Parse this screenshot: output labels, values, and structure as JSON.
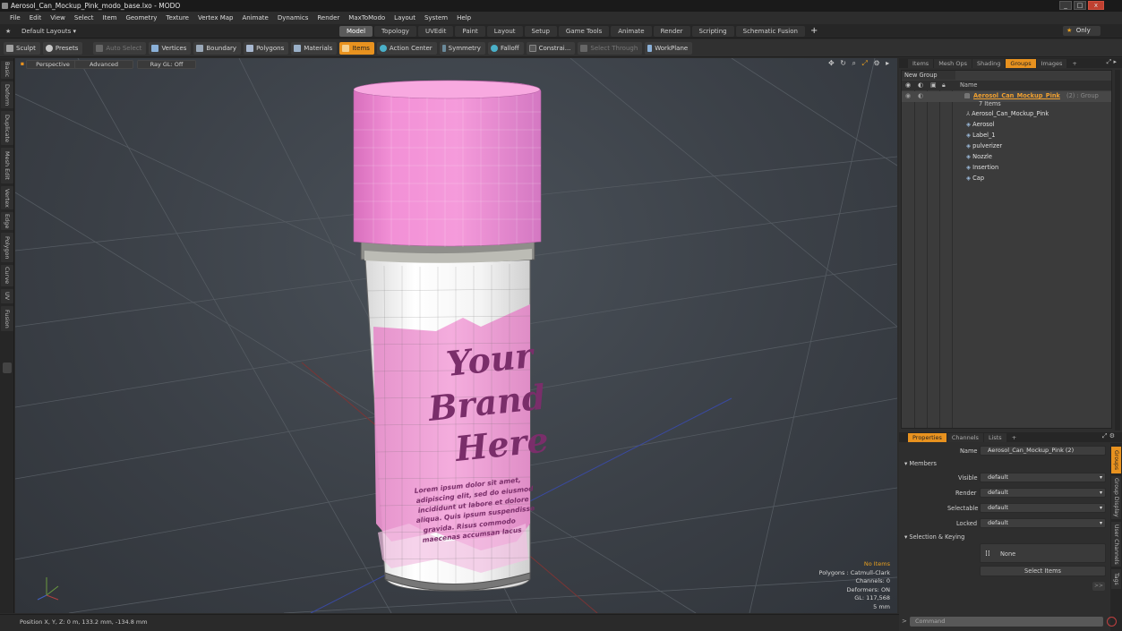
{
  "window": {
    "title": "Aerosol_Can_Mockup_Pink_modo_base.lxo - MODO",
    "controls": [
      "_",
      "□",
      "x"
    ]
  },
  "menu": [
    "File",
    "Edit",
    "View",
    "Select",
    "Item",
    "Geometry",
    "Texture",
    "Vertex Map",
    "Animate",
    "Dynamics",
    "Render",
    "MaxToModo",
    "Layout",
    "System",
    "Help"
  ],
  "layouts": {
    "layout_select": "Default Layouts",
    "tabs": [
      "Model",
      "Topology",
      "UVEdit",
      "Paint",
      "Layout",
      "Setup",
      "Game Tools",
      "Animate",
      "Render",
      "Scripting",
      "Schematic Fusion"
    ],
    "active": "Model",
    "add": "+",
    "only": "Only"
  },
  "toolbar": {
    "sculpt": "Sculpt",
    "presets": "Presets",
    "auto_select": "Auto Select",
    "vertices": "Vertices",
    "boundary": "Boundary",
    "polygons": "Polygons",
    "materials": "Materials",
    "items": "Items",
    "action_center": "Action Center",
    "symmetry": "Symmetry",
    "falloff": "Falloff",
    "constraints": "Constrai...",
    "select_through": "Select Through",
    "workplane": "WorkPlane"
  },
  "left_tabs": [
    "Basic",
    "Deform",
    "Duplicate",
    "Mesh Edit",
    "Vertex",
    "Edge",
    "Polygon",
    "Curve",
    "UV",
    "Fusion"
  ],
  "viewport": {
    "view_mode": "Perspective",
    "shading": "Advanced",
    "ray_gl": "Ray GL: Off",
    "label_text": [
      "Your",
      "Brand",
      "Here"
    ],
    "lorem": [
      "Lorem ipsum dolor sit amet,",
      "adipiscing elit, sed do eiusmod",
      "incididunt ut labore et dolore",
      "aliqua. Quis ipsum suspendisse",
      "gravida. Risus commodo",
      "maecenas accumsan lacus"
    ],
    "stats": {
      "no_items": "No Items",
      "polygons": "Polygons : Catmull-Clark",
      "channels": "Channels: 0",
      "deformers": "Deformers: ON",
      "gl": "GL: 117,568",
      "unit": "5 mm"
    },
    "colors": {
      "can_pink": "#ee8fd1",
      "text_purple": "#7a2e6a",
      "band": "#8a8a86"
    }
  },
  "status": {
    "position": "Position X, Y, Z:  0 m, 133.2 mm, -134.8 mm"
  },
  "right_panel": {
    "top_tabs": [
      "Items",
      "Mesh Ops",
      "Shading",
      "Groups",
      "Images",
      "+"
    ],
    "active_top_tab": "Groups",
    "new_group": "New Group",
    "name_header": "Name",
    "group": {
      "name": "Aerosol_Can_Mockup_Pink",
      "suffix": "(2) : Group",
      "count": "7 Items",
      "children": [
        "Aerosol_Can_Mockup_Pink",
        "Aerosol",
        "Label_1",
        "pulverizer",
        "Nozzle",
        "Insertion",
        "Cap"
      ]
    },
    "props_tabs": [
      "Properties",
      "Channels",
      "Lists",
      "+"
    ],
    "active_props_tab": "Properties",
    "name_label": "Name",
    "name_value": "Aerosol_Can_Mockup_Pink (2)",
    "members_section": "Members",
    "fields": [
      {
        "label": "Visible",
        "value": "default"
      },
      {
        "label": "Render",
        "value": "default"
      },
      {
        "label": "Selectable",
        "value": "default"
      },
      {
        "label": "Locked",
        "value": "default"
      }
    ],
    "selection_section": "Selection & Keying",
    "none_label": "None",
    "select_items": "Select Items",
    "more": ">>",
    "side_tabs": [
      "Groups",
      "Group Display",
      "User Channels",
      "Tags"
    ],
    "command_placeholder": "Command"
  }
}
